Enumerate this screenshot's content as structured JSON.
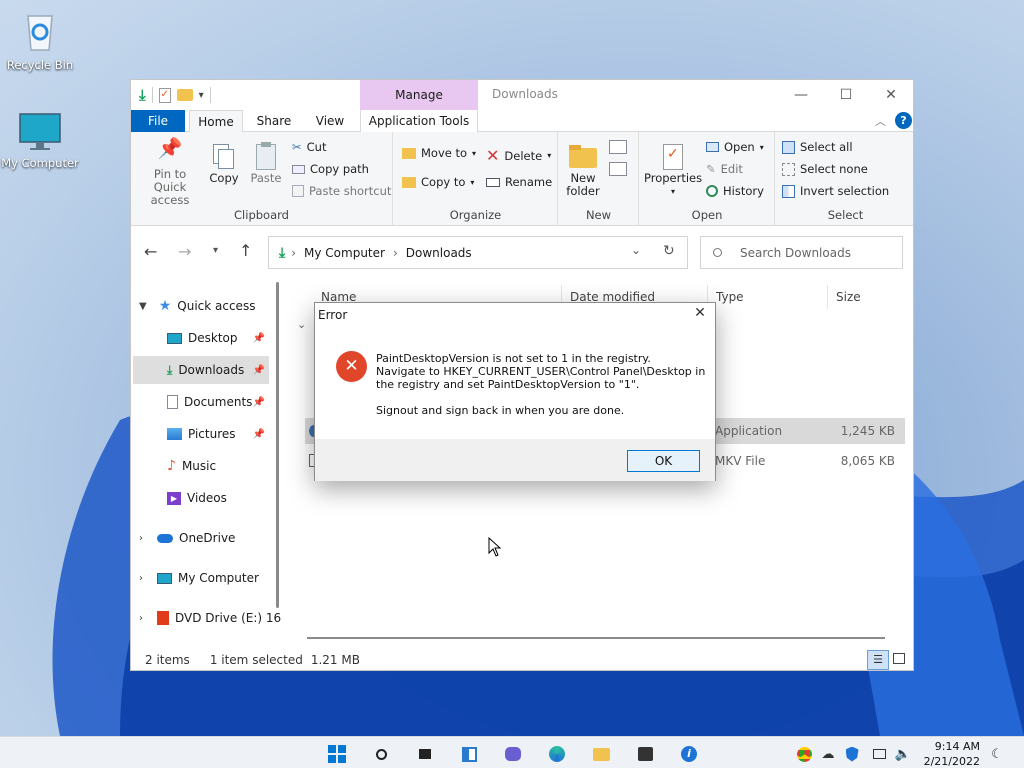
{
  "desktop": {
    "icons": [
      {
        "label": "Recycle Bin"
      },
      {
        "label": "My Computer"
      }
    ]
  },
  "window": {
    "title": "Downloads",
    "manage_tab": "Manage",
    "tabs": {
      "file": "File",
      "home": "Home",
      "share": "Share",
      "view": "View",
      "app_tools": "Application Tools"
    },
    "ribbon": {
      "clipboard": {
        "pin": "Pin to Quick access",
        "copy": "Copy",
        "paste": "Paste",
        "cut": "Cut",
        "copy_path": "Copy path",
        "paste_shortcut": "Paste shortcut",
        "label": "Clipboard"
      },
      "organize": {
        "move_to": "Move to",
        "copy_to": "Copy to",
        "delete": "Delete",
        "rename": "Rename",
        "label": "Organize"
      },
      "new": {
        "new_folder": "New folder",
        "label": "New"
      },
      "open": {
        "properties": "Properties",
        "open": "Open",
        "edit": "Edit",
        "history": "History",
        "label": "Open"
      },
      "select": {
        "select_all": "Select all",
        "select_none": "Select none",
        "invert": "Invert selection",
        "label": "Select"
      }
    },
    "address": {
      "crumbs": [
        "My Computer",
        "Downloads"
      ],
      "search_placeholder": "Search Downloads"
    },
    "nav": {
      "quick_access": "Quick access",
      "items": [
        {
          "label": "Desktop"
        },
        {
          "label": "Downloads"
        },
        {
          "label": "Documents"
        },
        {
          "label": "Pictures"
        },
        {
          "label": "Music"
        },
        {
          "label": "Videos"
        }
      ],
      "onedrive": "OneDrive",
      "my_computer": "My Computer",
      "dvd": "DVD Drive (E:) 16"
    },
    "columns": {
      "name": "Name",
      "date": "Date modified",
      "type": "Type",
      "size": "Size"
    },
    "files": [
      {
        "type": "Application",
        "size": "1,245 KB"
      },
      {
        "type": "MKV File",
        "size": "8,065 KB"
      }
    ],
    "status": {
      "count": "2 items",
      "selected": "1 item selected",
      "size": "1.21 MB"
    }
  },
  "dialog": {
    "title": "Error",
    "line1": "PaintDesktopVersion is not set to 1 in the registry.",
    "line2": "Navigate to HKEY_CURRENT_USER\\Control Panel\\Desktop in",
    "line3": "the registry and set PaintDesktopVersion to \"1\".",
    "line4": "Signout and sign back in when you are done.",
    "ok": "OK"
  },
  "taskbar": {
    "time": "9:14 AM",
    "date": "2/21/2022"
  },
  "colors": {
    "accent": "#0078d4",
    "manage_tab": "#e8c8f0",
    "error": "#e0462a"
  }
}
